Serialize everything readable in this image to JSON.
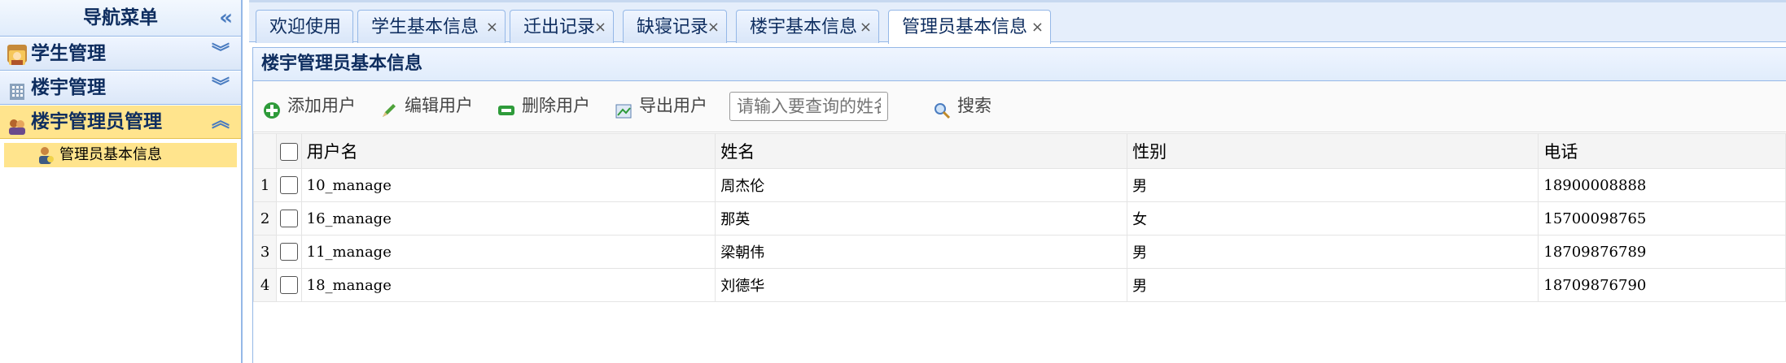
{
  "nav": {
    "title": "导航菜单",
    "collapse_icon": "double-chevron-left-icon",
    "groups": [
      {
        "label": "学生管理",
        "icon": "student-icon",
        "expanded": false
      },
      {
        "label": "楼宇管理",
        "icon": "building-icon",
        "expanded": false
      },
      {
        "label": "楼宇管理员管理",
        "icon": "admin-group-icon",
        "expanded": true
      }
    ],
    "active_item": {
      "label": "管理员基本信息",
      "icon": "admin-user-icon"
    }
  },
  "tabs": [
    {
      "label": "欢迎使用",
      "closable": false
    },
    {
      "label": "学生基本信息",
      "closable": true
    },
    {
      "label": "迁出记录",
      "closable": true
    },
    {
      "label": "缺寝记录",
      "closable": true
    },
    {
      "label": "楼宇基本信息",
      "closable": true
    },
    {
      "label": "管理员基本信息",
      "closable": true,
      "active": true
    }
  ],
  "close_glyph": "×",
  "panel": {
    "title": "楼宇管理员基本信息"
  },
  "toolbar": {
    "add_label": "添加用户",
    "edit_label": "编辑用户",
    "delete_label": "删除用户",
    "export_label": "导出用户",
    "search_placeholder": "请输入要查询的姓名",
    "search_label": "搜索"
  },
  "table": {
    "columns": [
      "用户名",
      "姓名",
      "性别",
      "电话"
    ],
    "rows": [
      {
        "num": "1",
        "username": "10_manage",
        "name": "周杰伦",
        "gender": "男",
        "phone": "18900008888"
      },
      {
        "num": "2",
        "username": "16_manage",
        "name": "那英",
        "gender": "女",
        "phone": "15700098765"
      },
      {
        "num": "3",
        "username": "11_manage",
        "name": "梁朝伟",
        "gender": "男",
        "phone": "18709876789"
      },
      {
        "num": "4",
        "username": "18_manage",
        "name": "刘德华",
        "gender": "男",
        "phone": "18709876790"
      }
    ]
  },
  "colors": {
    "accent": "#95b8e7",
    "active_highlight": "#ffe48d",
    "title_text": "#0e2d5f"
  }
}
